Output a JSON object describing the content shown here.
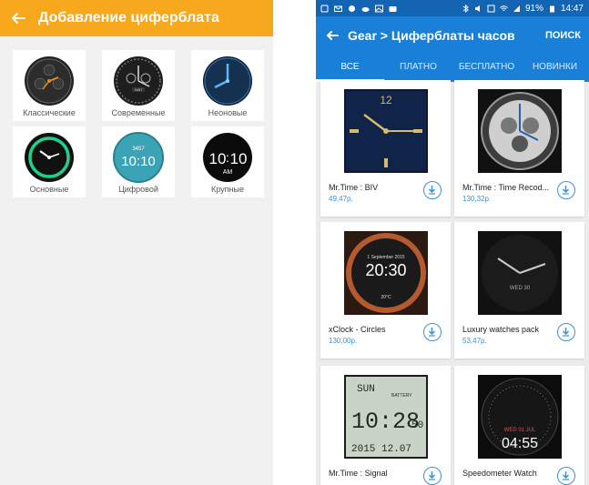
{
  "left_panel": {
    "title": "Добавление циферблата",
    "header_color": "#f8a81c",
    "faces": [
      {
        "label": "Классические",
        "icon": "classic-watch-face-icon"
      },
      {
        "label": "Современные",
        "icon": "modern-watch-face-icon"
      },
      {
        "label": "Неоновые",
        "icon": "neon-watch-face-icon"
      },
      {
        "label": "Основные",
        "icon": "basic-watch-face-icon"
      },
      {
        "label": "Цифровой",
        "icon": "digital-watch-face-icon",
        "digits_top": "3457",
        "time": "10:10"
      },
      {
        "label": "Крупные",
        "icon": "large-watch-face-icon",
        "time_h": "10",
        "time_m": "10",
        "ampm": "AM"
      }
    ]
  },
  "right_panel": {
    "status_bar": {
      "battery": "91%",
      "time": "14:47"
    },
    "app_bar": {
      "title": "Gear > Циферблаты часов",
      "search_label": "ПОИСК",
      "color": "#1a7fd6"
    },
    "tabs": [
      {
        "label": "ВСЕ",
        "active": true
      },
      {
        "label": "ПЛАТНО",
        "active": false
      },
      {
        "label": "БЕСПЛАТНО",
        "active": false
      },
      {
        "label": "НОВИНКИ",
        "active": false
      }
    ],
    "items": [
      {
        "name": "Mr.Time : BIV",
        "price": "49,47р.",
        "thumb_digits": "12"
      },
      {
        "name": "Mr.Time : Time Recod...",
        "price": "130,32р."
      },
      {
        "name": "xClock - Circles",
        "price": "130,00р.",
        "thumb_date": "1 September 2015",
        "thumb_time": "20:30",
        "thumb_temp": "20°C"
      },
      {
        "name": "Luxury watches pack",
        "price": "53,47р.",
        "thumb_day": "WED 30"
      },
      {
        "name": "Mr.Time : Signal",
        "price": "",
        "thumb_day": "SUN",
        "thumb_battery": "BATTERY",
        "thumb_time": "10:28",
        "thumb_sec": "50",
        "thumb_date": "2015 12.07"
      },
      {
        "name": "Speedometer Watch",
        "price": "",
        "thumb_day": "WED 01 JUL",
        "thumb_time": "04:55"
      }
    ]
  }
}
